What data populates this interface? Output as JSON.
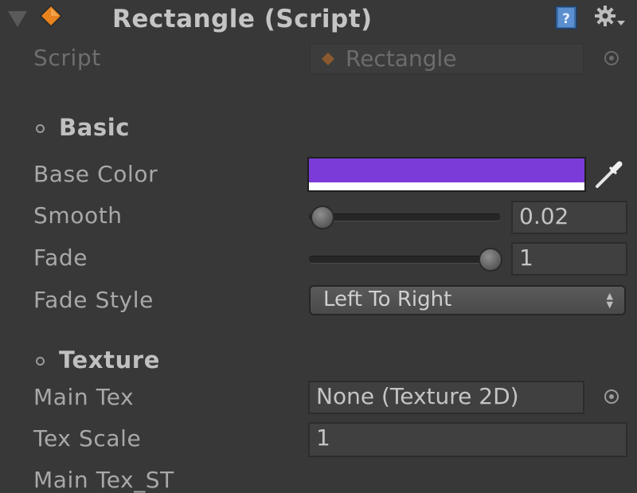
{
  "header": {
    "title": "Rectangle (Script)",
    "icons": {
      "fold": "foldout-arrow-icon",
      "component": "orange-diamond-icon",
      "help": "help-book-icon",
      "settings": "gear-icon"
    }
  },
  "script_row": {
    "label": "Script",
    "value": "Rectangle"
  },
  "sections": {
    "basic": {
      "title": "Basic"
    },
    "texture": {
      "title": "Texture"
    }
  },
  "fields": {
    "base_color": {
      "label": "Base Color",
      "color": "#7b3bd8",
      "alpha": 1.0
    },
    "smooth": {
      "label": "Smooth",
      "value": "0.02",
      "fraction": 0.02
    },
    "fade": {
      "label": "Fade",
      "value": "1",
      "fraction": 1.0
    },
    "fade_style": {
      "label": "Fade Style",
      "selected": "Left To Right"
    },
    "main_tex": {
      "label": "Main Tex",
      "value": "None (Texture 2D)"
    },
    "tex_scale": {
      "label": "Tex Scale",
      "value": "1"
    },
    "main_tex_st": {
      "label": "Main Tex_ST"
    }
  },
  "colors": {
    "background": "#383838",
    "accent_orange": "#e8831f",
    "base_color": "#7b3bd8"
  }
}
